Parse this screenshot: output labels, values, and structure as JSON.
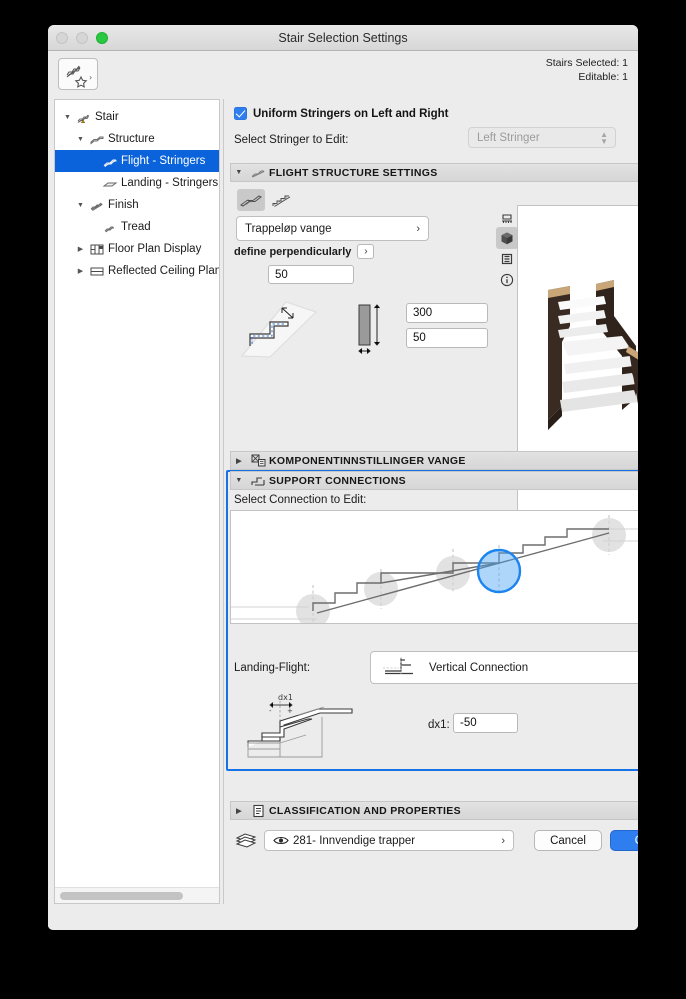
{
  "window": {
    "title": "Stair Selection Settings"
  },
  "header": {
    "favorites_icon": "stair-favorite-icon",
    "stairs_selected": "Stairs Selected: 1",
    "editable": "Editable: 1"
  },
  "sidebar": {
    "items": [
      {
        "label": "Stair",
        "icon": "stair-warning-icon",
        "twisty": "▼",
        "indent": 0,
        "selected": false
      },
      {
        "label": "Structure",
        "icon": "structure-icon",
        "twisty": "▼",
        "indent": 1,
        "selected": false
      },
      {
        "label": "Flight - Stringers",
        "icon": "stringer-icon",
        "twisty": "",
        "indent": 2,
        "selected": true
      },
      {
        "label": "Landing - Stringers",
        "icon": "landing-stringer-icon",
        "twisty": "",
        "indent": 2,
        "selected": false
      },
      {
        "label": "Finish",
        "icon": "finish-icon",
        "twisty": "▼",
        "indent": 1,
        "selected": false
      },
      {
        "label": "Tread",
        "icon": "tread-icon",
        "twisty": "",
        "indent": 2,
        "selected": false
      },
      {
        "label": "Floor Plan Display",
        "icon": "floor-plan-display-icon",
        "twisty": "▶",
        "indent": 1,
        "selected": false
      },
      {
        "label": "Reflected Ceiling Plan D",
        "icon": "reflected-ceiling-icon",
        "twisty": "▶",
        "indent": 1,
        "selected": false
      }
    ]
  },
  "main": {
    "uniform_stringers": {
      "label": "Uniform Stringers on Left and Right",
      "checked": true
    },
    "select_stringer": {
      "label": "Select Stringer to Edit:",
      "value": "Left Stringer",
      "disabled": true
    },
    "flight_structure": {
      "section_title": "FLIGHT STRUCTURE SETTINGS",
      "section_icon": "stringer-icon",
      "twisty": "▼",
      "mode_buttons": [
        {
          "name": "monolithic-stringer-button",
          "selected": true
        },
        {
          "name": "stepped-stringer-button",
          "selected": false
        }
      ],
      "structure_popup": "Trappeløp vange",
      "define_label": "define perpendicularly",
      "define_arrow": "›",
      "offset_value": "50",
      "height_value": "300",
      "thickness_value": "50",
      "preview_buttons": [
        {
          "name": "floor-plan-view-icon",
          "selected": false
        },
        {
          "name": "3d-view-icon",
          "selected": true
        },
        {
          "name": "section-view-icon",
          "selected": false
        },
        {
          "name": "info-icon",
          "selected": false
        }
      ]
    },
    "component_settings": {
      "section_title": "KOMPONENTINNSTILLINGER VANGE",
      "section_icon": "component-settings-icon",
      "twisty": "▶"
    },
    "support_connections": {
      "section_title": "SUPPORT CONNECTIONS",
      "section_icon": "support-connection-icon",
      "twisty": "▼",
      "select_connection_label": "Select Connection to Edit:",
      "landing_flight_label": "Landing-Flight:",
      "connection_type": "Vertical Connection",
      "connection_arrow": "›",
      "dx1_label": "dx1:",
      "dx1_value": "-50",
      "dx1_diagram_label": "dx1",
      "highlighted": true
    },
    "classification": {
      "section_title": "CLASSIFICATION AND PROPERTIES",
      "section_icon": "classification-icon",
      "twisty": "▶"
    }
  },
  "footer": {
    "layer_icon": "layers-icon",
    "eye_icon": "eye-icon",
    "layer_value": "281- Innvendige trapper",
    "layer_arrow": "›",
    "cancel_label": "Cancel",
    "ok_label": "OK"
  },
  "colors": {
    "accent_blue": "#0a63da",
    "button_blue": "#2f7ef0",
    "highlight_border": "#1673e6",
    "window_bg": "#ececec"
  }
}
